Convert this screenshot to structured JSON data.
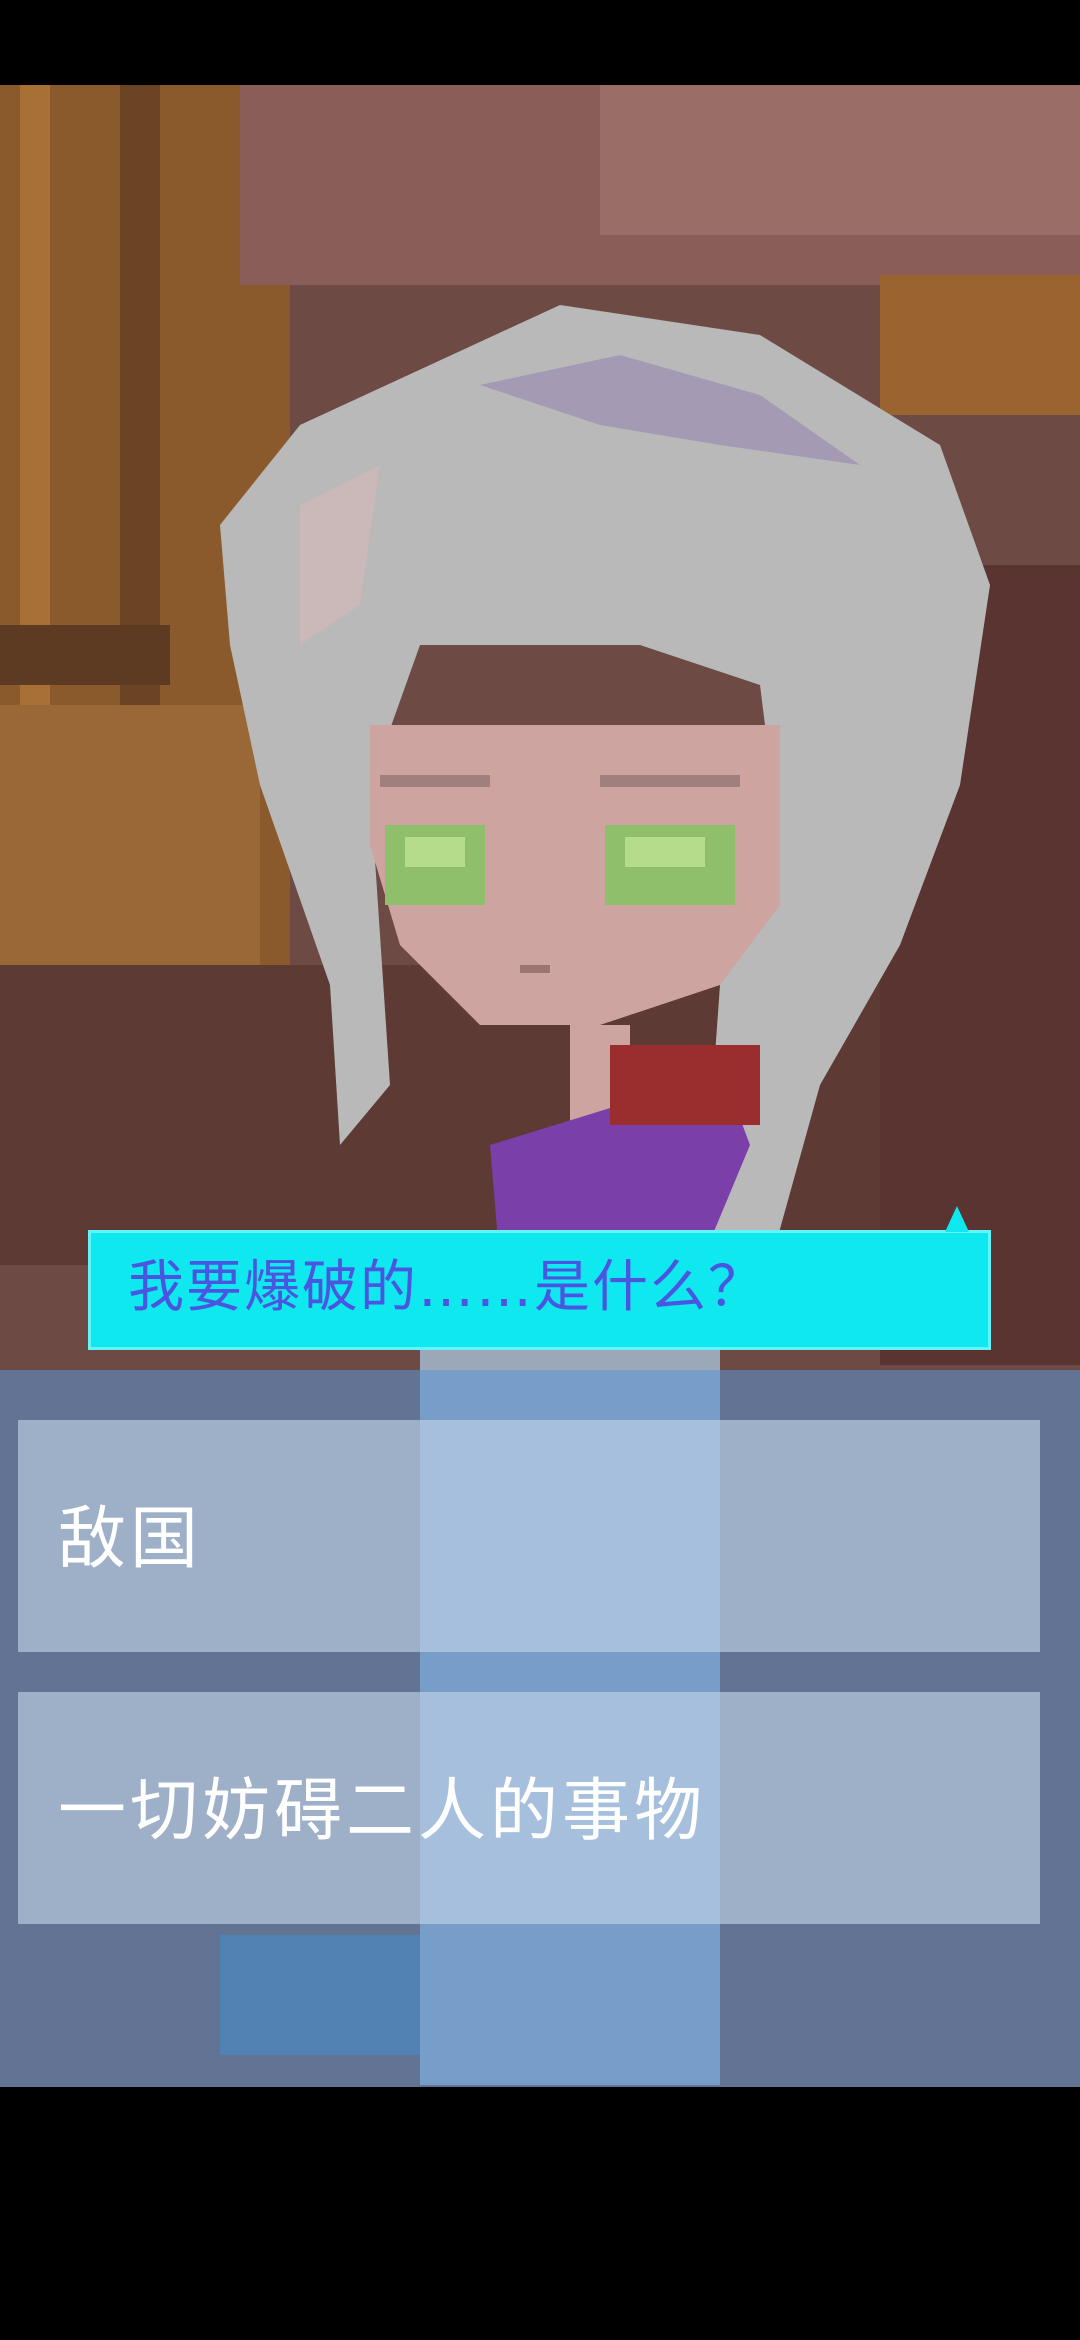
{
  "dialogue": {
    "text": "我要爆破的……是什么？"
  },
  "choices": [
    {
      "label": "敌国"
    },
    {
      "label": "一切妨碍二人的事物"
    }
  ],
  "colors": {
    "bubble": "#10e8f0",
    "bubble_text": "#4a55e0",
    "panel_overlay": "#5a96d7",
    "choice_box": "#c4d4e8"
  }
}
